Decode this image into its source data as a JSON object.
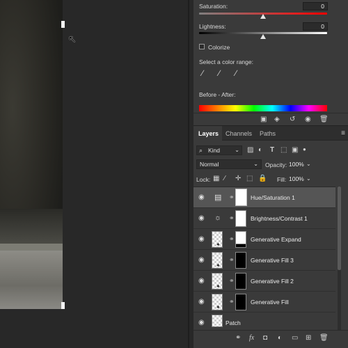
{
  "properties": {
    "saturation": {
      "label": "Saturation:",
      "value": "0",
      "level": 0.5
    },
    "lightness": {
      "label": "Lightness:",
      "value": "0",
      "level": 0.5
    },
    "colorize_label": "Colorize",
    "color_range_label": "Select a color range:",
    "before_after_label": "Before - After:"
  },
  "layers_panel": {
    "tabs": [
      {
        "label": "Layers"
      },
      {
        "label": "Channels"
      },
      {
        "label": "Paths"
      }
    ],
    "kind_filter": "Kind",
    "blend_mode": "Normal",
    "opacity_label": "Opacity:",
    "opacity_value": "100%",
    "lock_label": "Lock:",
    "fill_label": "Fill:",
    "fill_value": "100%",
    "layers": [
      {
        "name": "Hue/Saturation 1",
        "type": "adjustment-hue",
        "selected": true
      },
      {
        "name": "Brightness/Contrast 1",
        "type": "adjustment-brightness",
        "selected": false
      },
      {
        "name": "Generative Expand",
        "type": "generative",
        "selected": false
      },
      {
        "name": "Generative Fill 3",
        "type": "generative",
        "selected": false
      },
      {
        "name": "Generative Fill 2",
        "type": "generative",
        "selected": false
      },
      {
        "name": "Generative Fill",
        "type": "generative",
        "selected": false
      },
      {
        "name": "Patch",
        "type": "pixel",
        "selected": false
      }
    ]
  },
  "icons": {
    "eye": "eye-icon",
    "link": "link-icon",
    "trash": "trash-icon",
    "fx": "fx-icon"
  },
  "colors": {
    "panel_bg": "#3a3a3a",
    "selected_layer_bg": "#555555",
    "canvas_bg": "#282828"
  }
}
